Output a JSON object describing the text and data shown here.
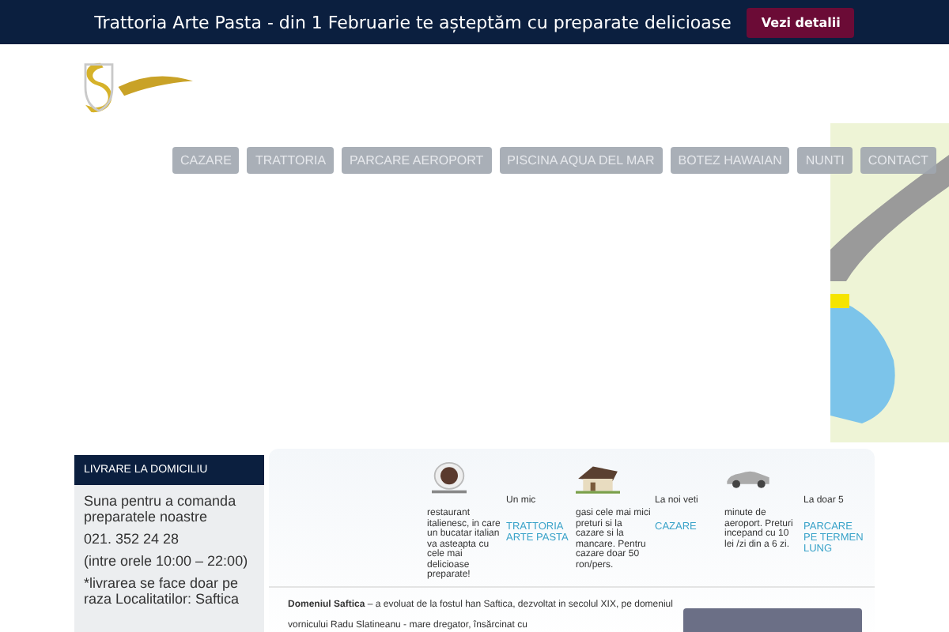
{
  "announcement": {
    "text": "Trattoria Arte Pasta - din 1 Februarie te așteptăm cu preparate delicioase",
    "button": "Vezi detalii"
  },
  "nav": [
    {
      "label": "CAZARE"
    },
    {
      "label": "TRATTORIA"
    },
    {
      "label": "PARCARE AEROPORT"
    },
    {
      "label": "PISCINA AQUA DEL MAR"
    },
    {
      "label": "BOTEZ HAWAIAN"
    },
    {
      "label": "NUNTI"
    },
    {
      "label": "CONTACT"
    }
  ],
  "sidebar": {
    "title": "LIVRARE LA DOMICILIU",
    "lines": [
      "Suna pentru a comanda preparatele noastre",
      "021. 352 24 28",
      "(intre orele 10:00 – 22:00)",
      "*livrarea se face doar pe raza Localitatilor: Saftica"
    ]
  },
  "features": [
    {
      "kind": "plate",
      "heading": "Un mic",
      "text": "restaurant italienesc, in care un bucatar italian va asteapta cu cele mai delicioase preparate!",
      "link": "TRATTORIA ARTE PASTA"
    },
    {
      "kind": "house",
      "heading": "La noi veti",
      "text": "gasi cele mai mici preturi si la cazare si la mancare. Pentru cazare doar 50 ron/pers.",
      "link": "CAZARE"
    },
    {
      "kind": "car",
      "heading": "La doar 5",
      "text": "minute de aeroport. Preturi incepand cu 10 lei /zi din a 6 zi.",
      "link": "PARCARE PE TERMEN LUNG"
    }
  ],
  "intro": "**Domeniul Saftica** – a evoluat de la fostul han Saftica, dezvoltat in secolul XIX, pe domeniul vornicului Radu Slatineanu - mare dregator, însărcinat cu"
}
